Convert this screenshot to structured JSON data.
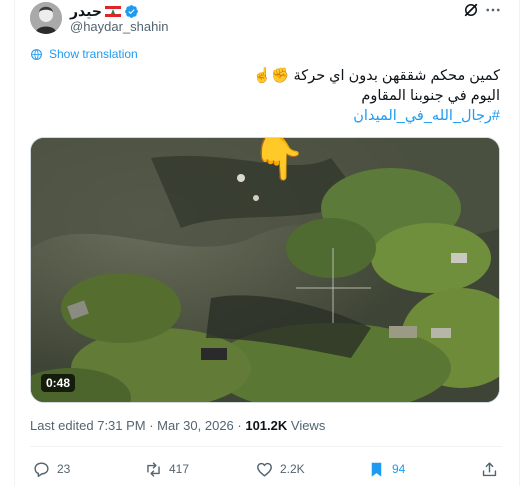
{
  "author": {
    "display_name": "حيدر",
    "handle": "@haydar_shahin",
    "flag_icon": "lebanon-flag-icon",
    "verified_color": "#1d9bf0"
  },
  "translate_label": "Show translation",
  "tweet": {
    "line1": "كمين محكم شققهن بدون اي حركة ✊☝️",
    "line2": "اليوم في جنوبنا المقاوم",
    "hashtag": "#رجال_الله_في_الميدان"
  },
  "media": {
    "duration": "0:48",
    "pointer_emoji": "👇"
  },
  "meta": {
    "edited": "Last edited 7:31 PM · Mar 30, 2026 · ",
    "views_count": "101.2K",
    "views_label": " Views"
  },
  "actions": {
    "replies": "23",
    "reposts": "417",
    "likes": "2.2K",
    "bookmarks": "94"
  },
  "colors": {
    "accent": "#1d9bf0",
    "muted": "#536471",
    "text": "#0f1419"
  }
}
